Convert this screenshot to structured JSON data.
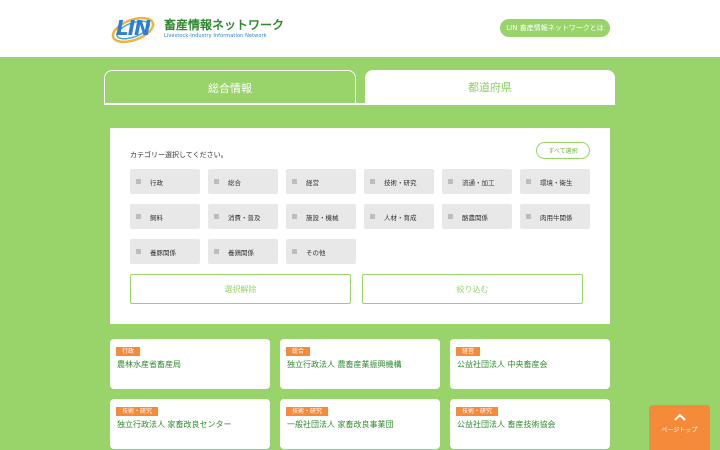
{
  "header": {
    "logo_mark": "LIN",
    "title": "畜産情報ネットワーク",
    "subtitle": "Livestock-Industry Information Network",
    "about_label": "LIN 畜産情報ネットワークとは"
  },
  "tabs": [
    {
      "label": "総合情報",
      "active": true
    },
    {
      "label": "都道府県",
      "active": false
    }
  ],
  "panel": {
    "prompt": "カテゴリー選択してください。",
    "select_all": "すべて選択",
    "categories": [
      {
        "label": "行政",
        "checked": false
      },
      {
        "label": "総合",
        "checked": false
      },
      {
        "label": "経営",
        "checked": false
      },
      {
        "label": "技術・研究",
        "checked": false
      },
      {
        "label": "流通・加工",
        "checked": false
      },
      {
        "label": "環境・衛生",
        "checked": false
      },
      {
        "label": "飼料",
        "checked": false
      },
      {
        "label": "消費・普及",
        "checked": false
      },
      {
        "label": "施設・機械",
        "checked": false
      },
      {
        "label": "人材・育成",
        "checked": false
      },
      {
        "label": "酪農関係",
        "checked": false
      },
      {
        "label": "肉用牛関係",
        "checked": false
      },
      {
        "label": "養豚関係",
        "checked": false
      },
      {
        "label": "養鶏関係",
        "checked": false
      },
      {
        "label": "その他",
        "checked": false
      }
    ],
    "clear_label": "選択解除",
    "filter_label": "絞り込む"
  },
  "results": [
    {
      "tag": "行政",
      "name": "農林水産省畜産局"
    },
    {
      "tag": "総合",
      "name": "独立行政法人 農畜産業振興機構"
    },
    {
      "tag": "経営",
      "name": "公益社団法人 中央畜産会"
    },
    {
      "tag": "技術・研究",
      "name": "独立行政法人 家畜改良センター"
    },
    {
      "tag": "技術・研究",
      "name": "一般社団法人 家畜改良事業団"
    },
    {
      "tag": "技術・研究",
      "name": "公益社団法人 畜産技術協会"
    }
  ],
  "page_top": {
    "label": "ページトップ",
    "icon": "chevron-up-icon"
  },
  "colors": {
    "green": "#98d46a",
    "orange": "#f58a3a",
    "dark_green": "#2f8a2f",
    "logo_blue": "#2a7fd0"
  }
}
